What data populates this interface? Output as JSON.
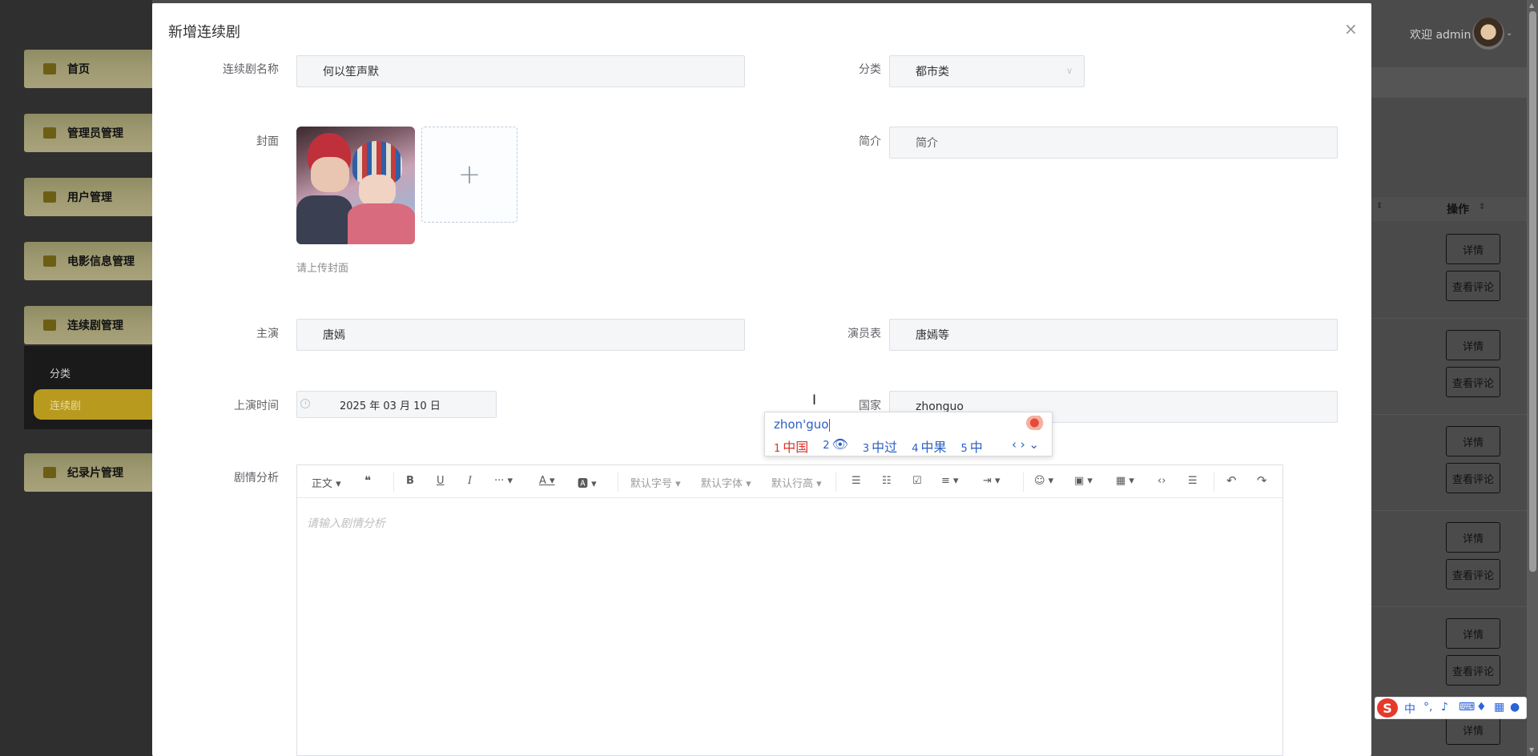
{
  "sidebar": {
    "items": [
      {
        "label": "首页"
      },
      {
        "label": "管理员管理"
      },
      {
        "label": "用户管理"
      },
      {
        "label": "电影信息管理"
      },
      {
        "label": "连续剧管理"
      },
      {
        "label": "纪录片管理"
      }
    ],
    "submenu": [
      {
        "label": "分类"
      },
      {
        "label": "连续剧"
      }
    ]
  },
  "header": {
    "welcome": "欢迎 admin",
    "caret": "⌄"
  },
  "table": {
    "op_header": "操作",
    "detail_label": "详情",
    "comment_label": "查看评论"
  },
  "dialog": {
    "title": "新增连续剧",
    "close": "×",
    "fields": {
      "name": {
        "label": "连续剧名称",
        "value": "何以笙声默"
      },
      "category": {
        "label": "分类",
        "value": "都市类"
      },
      "cover": {
        "label": "封面",
        "tip": "请上传封面",
        "add": "+"
      },
      "intro": {
        "label": "简介",
        "placeholder": "简介"
      },
      "lead": {
        "label": "主演",
        "value": "唐嫣"
      },
      "cast": {
        "label": "演员表",
        "value": "唐嫣等"
      },
      "release": {
        "label": "上演时间",
        "value": "2025 年 03 月 10 日"
      },
      "country": {
        "label": "国家",
        "value": "zhonguo"
      },
      "analysis": {
        "label": "剧情分析",
        "placeholder": "请输入剧情分析"
      }
    },
    "toolbar": {
      "paragraph": "正文 ▾",
      "quote": "❝",
      "bold": "B",
      "underline": "U",
      "italic": "I",
      "more": "··· ▾",
      "font_color": "A ▾",
      "bg_color": "🅰 ▾",
      "font_size": "默认字号 ▾",
      "font_family": "默认字体 ▾",
      "line_height": "默认行高 ▾",
      "bullet_list": "☰",
      "numbered_list": "☷",
      "todo": "☑",
      "align": "≡ ▾",
      "indent": "⇥ ▾",
      "emoji": "☺ ▾",
      "image": "▣ ▾",
      "table": "▦ ▾",
      "code": "‹›",
      "divider": "☰",
      "undo": "↶",
      "redo": "↷"
    }
  },
  "ime": {
    "pinyin": "zhon'guo",
    "candidates": [
      {
        "num": "1",
        "text": "中国"
      },
      {
        "num": "2",
        "text": "👁"
      },
      {
        "num": "3",
        "text": "中过"
      },
      {
        "num": "4",
        "text": "中果"
      },
      {
        "num": "5",
        "text": "中"
      }
    ],
    "nav": "‹ › ⌄",
    "status_logo": "S",
    "status_lang": "中"
  },
  "colors": {
    "menu_gradient": "#a9a27a",
    "active_sub": "#b89a1f",
    "ime_blue": "#2b5fc4",
    "ime_red": "#d9342b"
  }
}
